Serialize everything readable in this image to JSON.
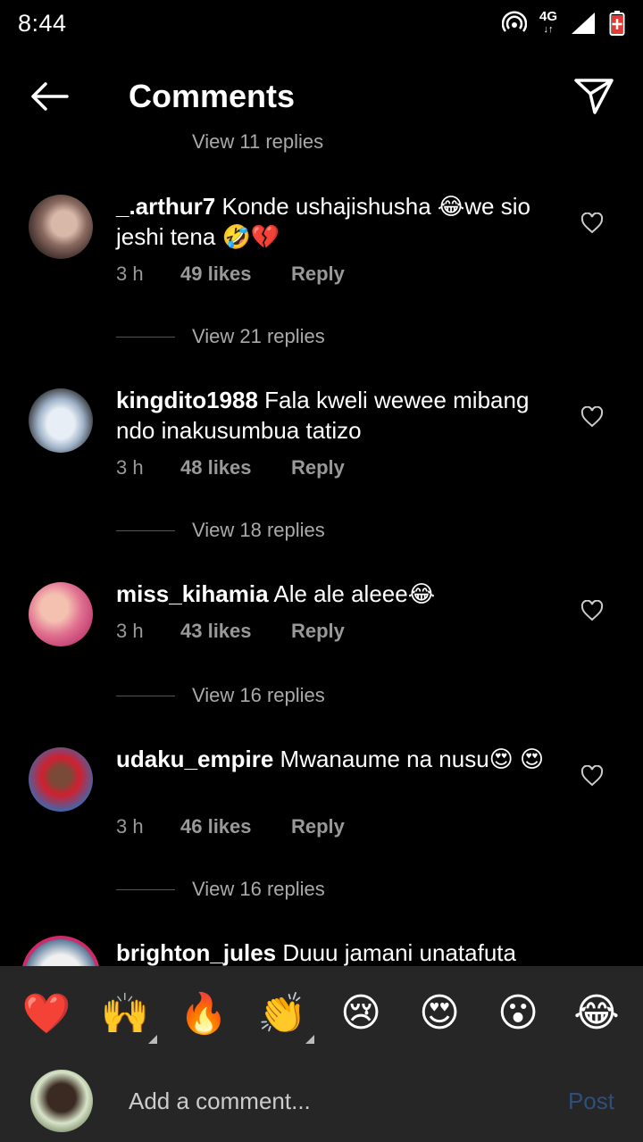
{
  "status_bar": {
    "time": "8:44",
    "network": "4G"
  },
  "header": {
    "title": "Comments"
  },
  "partial_view_replies": "View 11 replies",
  "comments": [
    {
      "username": "_.arthur7",
      "text": "Konde ushajishusha 😂we sio jeshi tena 🤣💔",
      "time": "3 h",
      "likes": "49 likes",
      "reply": "Reply",
      "view_replies": "View 21 replies"
    },
    {
      "username": "kingdito1988",
      "text": "Fala kweli wewee mibang ndo inakusumbua tatizo",
      "time": "3 h",
      "likes": "48 likes",
      "reply": "Reply",
      "view_replies": "View 18 replies"
    },
    {
      "username": "miss_kihamia",
      "text": "Ale ale aleee😂",
      "time": "3 h",
      "likes": "43 likes",
      "reply": "Reply",
      "view_replies": "View 16 replies"
    },
    {
      "username": "udaku_empire",
      "text": "Mwanaume na nusu😍 😍",
      "time": "3 h",
      "likes": "46 likes",
      "reply": "Reply",
      "view_replies": "View 16 replies"
    },
    {
      "username": "brighton_jules",
      "text": "Duuu jamani unatafuta"
    }
  ],
  "emoji_bar": [
    "❤️",
    "🙌",
    "🔥",
    "👏",
    "😢",
    "😍",
    "😮",
    "😂"
  ],
  "input": {
    "placeholder": "Add a comment...",
    "post_label": "Post"
  },
  "colors": {
    "background": "#000000",
    "bar": "#262626",
    "meta_text": "#999999",
    "post_disabled": "#2f4f7a"
  }
}
